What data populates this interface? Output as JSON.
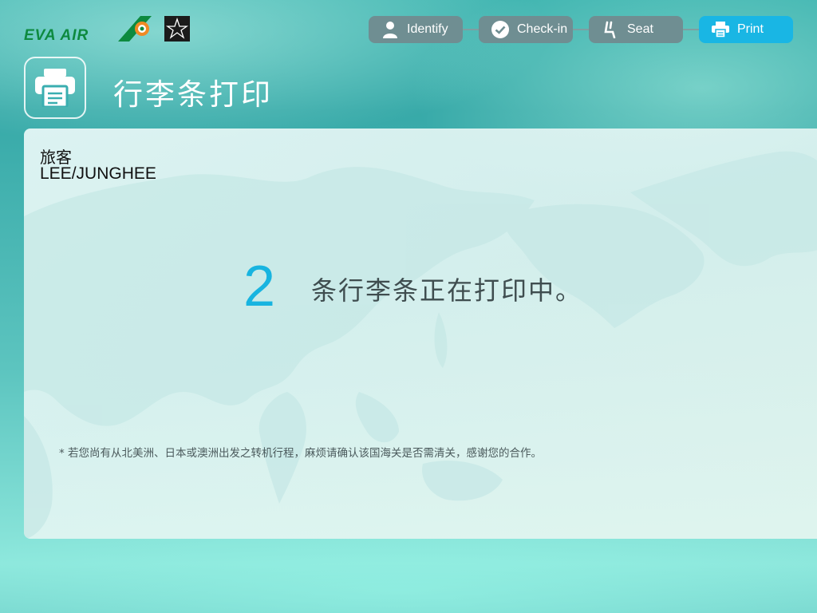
{
  "brand": {
    "logo_text": "EVA AIR",
    "alliance": "Star Alliance"
  },
  "steps": [
    {
      "label": "Identify",
      "icon": "user-icon",
      "active": false
    },
    {
      "label": "Check-in",
      "icon": "check-circle-icon",
      "active": false
    },
    {
      "label": "Seat",
      "icon": "seat-icon",
      "active": false
    },
    {
      "label": "Print",
      "icon": "printer-icon",
      "active": true
    }
  ],
  "colors": {
    "accent": "#19b6e4",
    "step_inactive": "#6f8e92",
    "brand_green": "#0d8a3f"
  },
  "header": {
    "title": "行李条打印",
    "title_icon": "printer-icon"
  },
  "main": {
    "passenger_label": "旅客",
    "passenger_name": "LEE/JUNGHEE",
    "tag_count": "2",
    "status_text": "条行李条正在打印中。",
    "note": "*  若您尚有从北美洲、日本或澳洲出发之转机行程，麻烦请确认该国海关是否需清关，感谢您的合作。"
  }
}
